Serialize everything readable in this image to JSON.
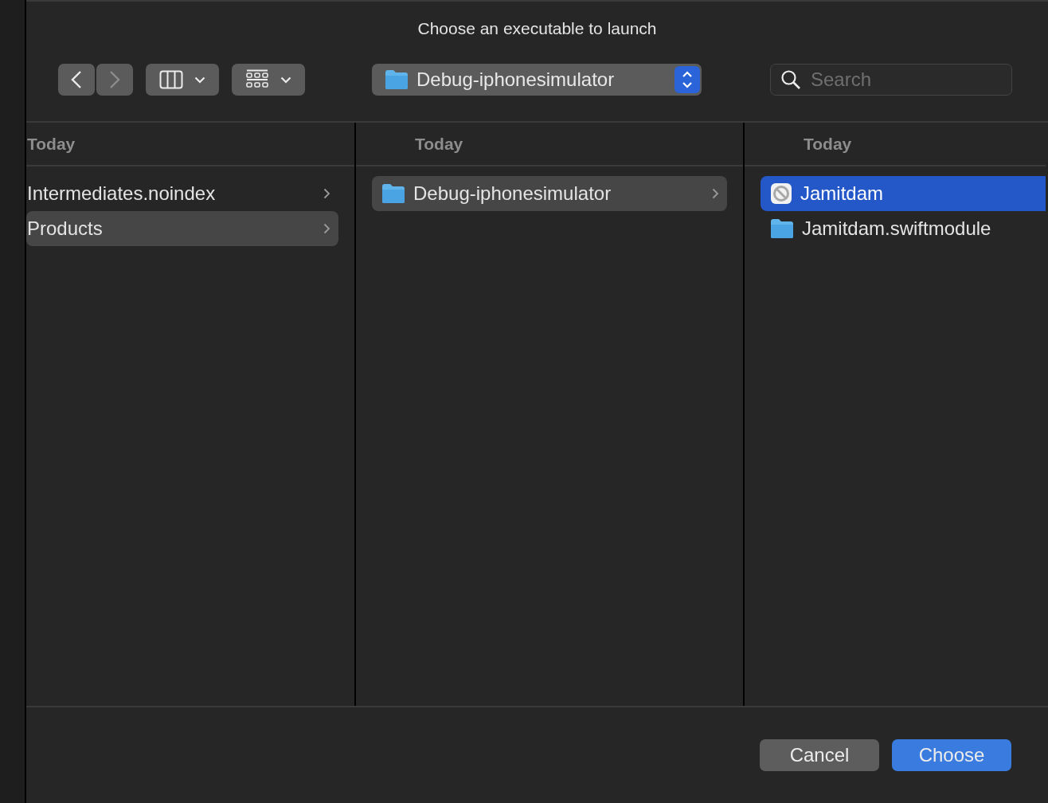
{
  "dialog": {
    "title": "Choose an executable to launch"
  },
  "toolbar": {
    "back": {
      "disabled": false
    },
    "forward": {
      "disabled": true
    },
    "path_popup": {
      "label": "Debug-iphonesimulator"
    },
    "search": {
      "placeholder": "Search"
    }
  },
  "columns": [
    {
      "header": "Today",
      "focused": false,
      "items": [
        {
          "name": "Intermediates.noindex",
          "kind": "plain",
          "has_children": true,
          "selected": false
        },
        {
          "name": "Products",
          "kind": "plain",
          "has_children": true,
          "selected": true
        }
      ]
    },
    {
      "header": "Today",
      "focused": false,
      "items": [
        {
          "name": "Debug-iphonesimulator",
          "kind": "folder",
          "has_children": true,
          "selected": true
        }
      ]
    },
    {
      "header": "Today",
      "focused": true,
      "items": [
        {
          "name": "Jamitdam",
          "kind": "app",
          "has_children": false,
          "selected": true
        },
        {
          "name": "Jamitdam.swiftmodule",
          "kind": "folder",
          "has_children": false,
          "selected": false
        }
      ]
    }
  ],
  "buttons": [
    {
      "label": "Cancel",
      "kind": "normal"
    },
    {
      "label": "Choose",
      "kind": "default"
    }
  ]
}
